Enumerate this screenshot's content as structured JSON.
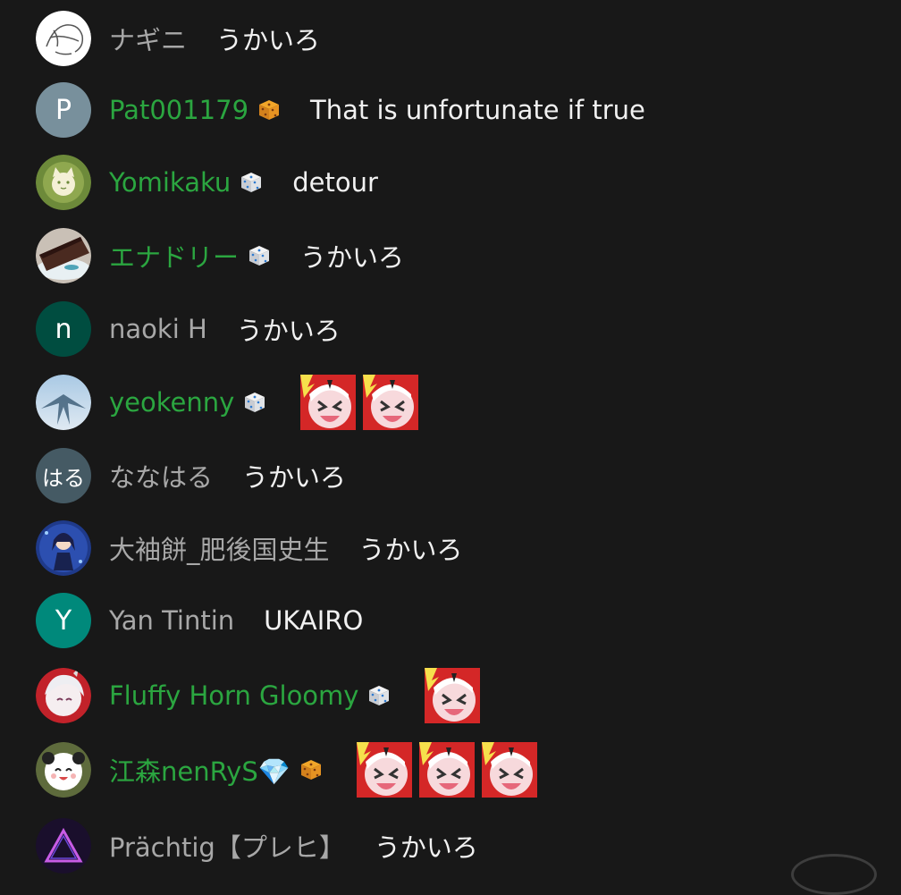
{
  "messages": [
    {
      "author": "ナギニ",
      "member": false,
      "badge": null,
      "text": "うかいろ",
      "avatar": {
        "type": "sketch"
      }
    },
    {
      "author": "Pat001179",
      "member": true,
      "badge": "gold-dice-badge",
      "text": "That is unfortunate if true",
      "avatar": {
        "type": "letter",
        "letter": "P",
        "color": "#78909c"
      }
    },
    {
      "author": "Yomikaku",
      "member": true,
      "badge": "white-dice-badge",
      "text": "detour",
      "avatar": {
        "type": "cat-latte"
      }
    },
    {
      "author": "エナドリー",
      "member": true,
      "badge": "white-dice-badge",
      "text": "うかいろ",
      "avatar": {
        "type": "cake"
      }
    },
    {
      "author": "naoki H",
      "member": false,
      "badge": null,
      "text": "うかいろ",
      "avatar": {
        "type": "letter",
        "letter": "n",
        "color": "#004d40"
      }
    },
    {
      "author": "yeokenny",
      "member": true,
      "badge": "white-dice-badge",
      "text": "",
      "emotes": 2,
      "avatar": {
        "type": "sky"
      }
    },
    {
      "author": "ななはる",
      "member": false,
      "badge": null,
      "text": "うかいろ",
      "avatar": {
        "type": "letter",
        "letter": "はる",
        "color": "#455a64"
      }
    },
    {
      "author": "大袖餅_肥後国史生",
      "member": false,
      "badge": null,
      "text": "うかいろ",
      "avatar": {
        "type": "anime-blue"
      }
    },
    {
      "author": "Yan Tintin",
      "member": false,
      "badge": null,
      "text": "UKAIRO",
      "avatar": {
        "type": "letter",
        "letter": "Y",
        "color": "#00897b"
      }
    },
    {
      "author": "Fluffy Horn Gloomy",
      "member": true,
      "badge": "white-dice-badge",
      "text": "",
      "emotes": 1,
      "avatar": {
        "type": "anime-white"
      }
    },
    {
      "author": "江森nenRyS💎",
      "member": true,
      "badge": "gold-dice-badge",
      "text": "",
      "emotes": 3,
      "avatar": {
        "type": "panda"
      }
    },
    {
      "author": "Prächtig【プレヒ】",
      "member": false,
      "badge": null,
      "text": "うかいろ",
      "avatar": {
        "type": "triangle"
      }
    }
  ],
  "colors": {
    "background": "#181818",
    "member_name": "#2ba640",
    "normal_name": "#a8a8a8",
    "message_text": "#f1f1f1"
  }
}
